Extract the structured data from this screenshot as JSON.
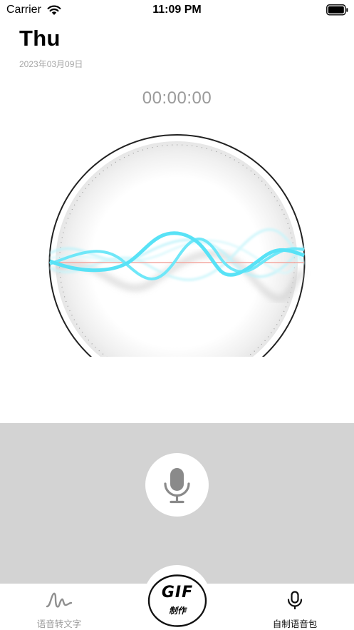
{
  "status_bar": {
    "carrier": "Carrier",
    "time": "11:09 PM",
    "wifi_icon": "wifi-icon",
    "battery_icon": "battery-icon"
  },
  "header": {
    "day": "Thu",
    "date": "2023年03月09日"
  },
  "recorder": {
    "elapsed": "00:00:00",
    "mic_icon": "microphone-icon",
    "wave_color": "#5ee6f7",
    "baseline_color": "#f4a7a0",
    "panel_color": "#d3d3d3"
  },
  "tab_bar": {
    "left": {
      "label": "语音转文字",
      "icon": "waveform-icon"
    },
    "center": {
      "title": "GIF",
      "subtitle": "制作"
    },
    "right": {
      "label": "自制语音包",
      "icon": "microphone-icon"
    }
  }
}
